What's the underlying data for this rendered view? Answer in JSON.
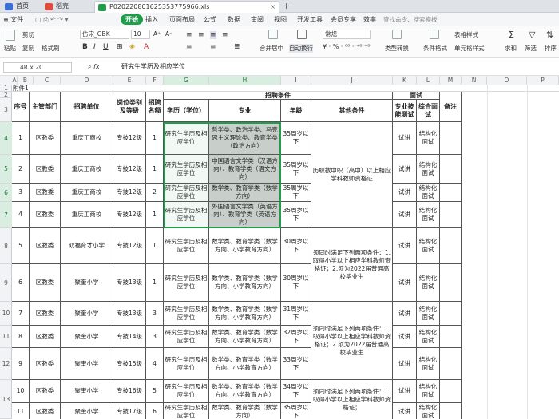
{
  "tabs": [
    {
      "label": "首页",
      "color": "#3b6fd4"
    },
    {
      "label": "稻壳",
      "color": "#e24a3b"
    },
    {
      "label": "P020220801625353775966.xls",
      "color": "#1f9d4b"
    }
  ],
  "menu": {
    "file": "≡ 文件",
    "items": [
      "开始",
      "插入",
      "页面布局",
      "公式",
      "数据",
      "审阅",
      "视图",
      "开发工具",
      "会员专享",
      "效率"
    ],
    "search_placeholder": "查找命令、搜索模板"
  },
  "ribbon": {
    "paste": "粘贴",
    "cut": "剪切",
    "copy": "复制",
    "format_painter": "格式刷",
    "font_name": "仿宋_GBK",
    "font_size": "10",
    "font_grow": "A⁺",
    "font_shrink": "A⁻",
    "merge_center": "合并居中",
    "wrap_text": "自动换行",
    "number_format": "常规",
    "type_convert": "类型转换",
    "conditional_format": "条件格式",
    "table_style": "表格样式",
    "cell_style": "单元格样式",
    "sum": "求和",
    "filter": "筛选",
    "sort": "排序"
  },
  "formula_bar": {
    "name_box": "4R x 2C",
    "fx": "fx",
    "content": "研究生学历及相应学位"
  },
  "columns": [
    "A",
    "B",
    "C",
    "D",
    "E",
    "F",
    "G",
    "H",
    "I",
    "J",
    "K",
    "L",
    "M",
    "N",
    "O",
    "P"
  ],
  "rows": [
    "1",
    "2",
    "3",
    "4",
    "5",
    "6",
    "7",
    "8",
    "9",
    "10",
    "11",
    "12",
    "13"
  ],
  "sheet": {
    "a1": "附件1",
    "headers": {
      "seq": "序号",
      "dept": "主管部门",
      "unit": "招聘单位",
      "post": "岗位类别及等级",
      "quota": "招聘名额",
      "conditions": "招聘条件",
      "education": "学历（学位）",
      "major": "专业",
      "age": "年龄",
      "other": "其他条件",
      "interview": "面试",
      "skill_test": "专业技能测试",
      "combined": "综合面试",
      "notes": "备注"
    },
    "records": [
      {
        "seq": "1",
        "dept": "区教委",
        "unit": "重庆工商校",
        "post": "专技12级",
        "quota": "1",
        "edu": "研究生学历及相应学位",
        "major": "哲学类、政治学类、马克思主义理论类、教育学类（政治方向）",
        "age": "35周岁以下",
        "skill": "试讲",
        "combined": "结构化面试"
      },
      {
        "seq": "2",
        "dept": "区教委",
        "unit": "重庆工商校",
        "post": "专技12级",
        "quota": "1",
        "edu": "研究生学历及相应学位",
        "major": "中国语言文学类（汉语方向）、教育学类（语文方向）",
        "age": "35周岁以下",
        "skill": "试讲",
        "combined": "结构化面试"
      },
      {
        "seq": "3",
        "dept": "区教委",
        "unit": "重庆工商校",
        "post": "专技12级",
        "quota": "2",
        "edu": "研究生学历及相应学位",
        "major": "数学类、教育学类（数学方向）",
        "age": "35周岁以下",
        "skill": "试讲",
        "combined": "结构化面试"
      },
      {
        "seq": "4",
        "dept": "区教委",
        "unit": "重庆工商校",
        "post": "专技12级",
        "quota": "1",
        "edu": "研究生学历及相应学位",
        "major": "外国语言文学类（英语方向）、教育学类（英语方向）",
        "age": "35周岁以下",
        "skill": "试讲",
        "combined": "结构化面试"
      },
      {
        "seq": "5",
        "dept": "区教委",
        "unit": "双福育才小学",
        "post": "专技12级",
        "quota": "1",
        "edu": "研究生学历及相应学位",
        "major": "数学类、教育学类（数学方向、小学教育方向）",
        "age": "30周岁以下",
        "skill": "试讲",
        "combined": "结构化面试"
      },
      {
        "seq": "6",
        "dept": "区教委",
        "unit": "聚奎小学",
        "post": "专技13级",
        "quota": "1",
        "edu": "研究生学历及相应学位",
        "major": "数学类、教育学类（数学方向、小学教育方向）",
        "age": "30周岁以下",
        "skill": "试讲",
        "combined": "结构化面试"
      },
      {
        "seq": "7",
        "dept": "区教委",
        "unit": "聚奎小学",
        "post": "专技13级",
        "quota": "3",
        "edu": "研究生学历及相应学位",
        "major": "数学类、教育学类（数学方向、小学教育方向）",
        "age": "31周岁以下",
        "skill": "试讲",
        "combined": "结构化面试"
      },
      {
        "seq": "8",
        "dept": "区教委",
        "unit": "聚奎小学",
        "post": "专技14级",
        "quota": "3",
        "edu": "研究生学历及相应学位",
        "major": "数学类、教育学类（数学方向、小学教育方向）",
        "age": "32周岁以下",
        "skill": "试讲",
        "combined": "结构化面试"
      },
      {
        "seq": "9",
        "dept": "区教委",
        "unit": "聚奎小学",
        "post": "专技15级",
        "quota": "4",
        "edu": "研究生学历及相应学位",
        "major": "数学类、教育学类（数学方向、小学教育方向）",
        "age": "33周岁以下",
        "skill": "试讲",
        "combined": "结构化面试"
      },
      {
        "seq": "10",
        "dept": "区教委",
        "unit": "聚奎小学",
        "post": "专技16级",
        "quota": "5",
        "edu": "研究生学历及相应学位",
        "major": "数学类、教育学类（数学方向、小学教育方向）",
        "age": "34周岁以下",
        "skill": "试讲",
        "combined": "结构化面试"
      },
      {
        "seq": "11",
        "dept": "区教委",
        "unit": "聚奎小学",
        "post": "专技17级",
        "quota": "6",
        "edu": "研究生学历及相应学位",
        "major": "数学类、教育学类（数学方向）",
        "age": "35周岁以下",
        "skill": "试讲",
        "combined": "结构化面试"
      }
    ],
    "other_conditions": {
      "group1": "历职教中职（高中）以上相应学科教师资格证",
      "group2": "须同时满足下列两项条件：1.取得小学以上相应学科教师资格证；2.须为2022届普通高校毕业生",
      "group3": "须同时满足下列两项条件：1.取得小学以上相应学科教师资格证；2.须为2022届普通高校毕业生",
      "group4": "须同时满足下列两项条件：1.取得小学以上相应学科教师资格证；"
    }
  }
}
